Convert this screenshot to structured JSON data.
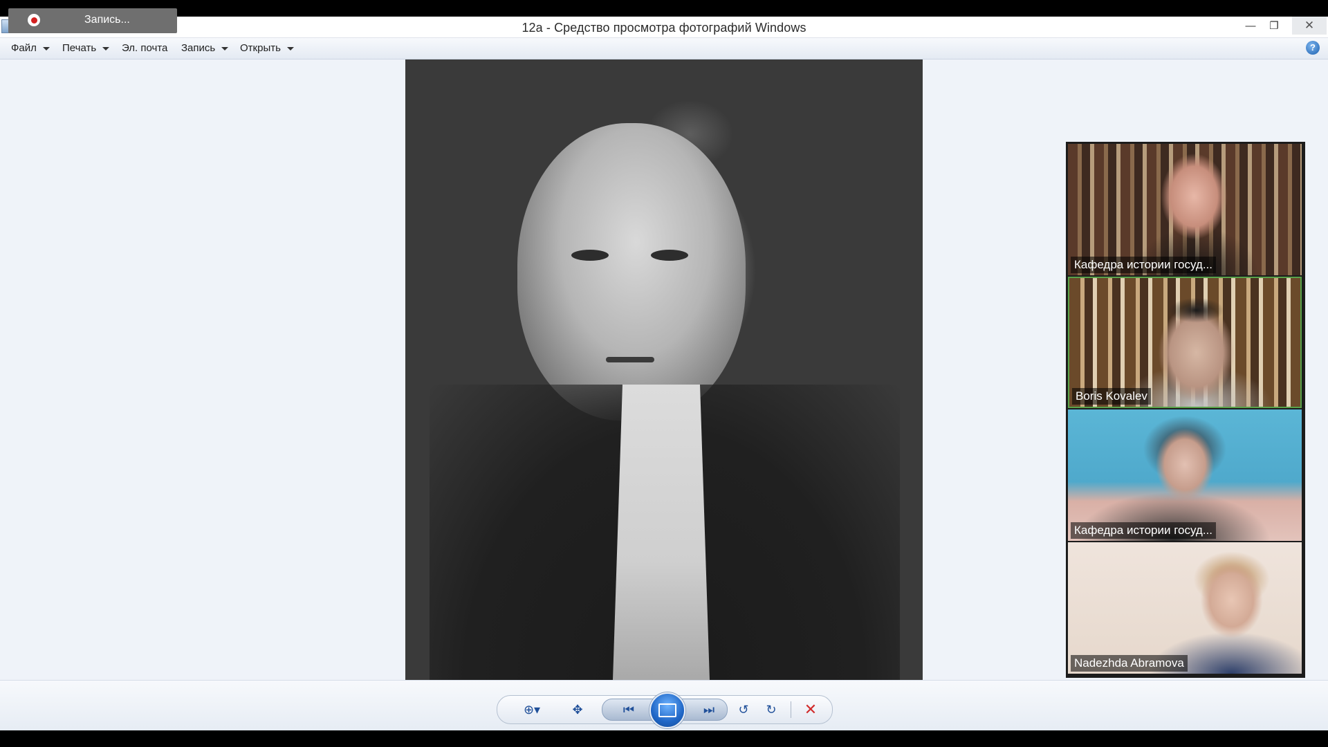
{
  "window": {
    "title": "12a - Средство просмотра фотографий Windows",
    "minimize_glyph": "—",
    "maximize_glyph": "❐",
    "close_glyph": "✕"
  },
  "recording": {
    "label": "Запись..."
  },
  "menu": {
    "items": [
      {
        "label": "Файл"
      },
      {
        "label": "Печать"
      },
      {
        "label": "Эл. почта"
      },
      {
        "label": "Запись"
      },
      {
        "label": "Открыть"
      }
    ],
    "help_glyph": "?"
  },
  "participants": [
    {
      "name": "Кафедра истории госуд..."
    },
    {
      "name": "Boris Kovalev"
    },
    {
      "name": "Кафедра истории госуд..."
    },
    {
      "name": "Nadezhda Abramova"
    }
  ],
  "controls": {
    "zoom_glyph": "⊕▾",
    "fit_glyph": "✥",
    "prev_glyph": "⏮",
    "next_glyph": "⏭",
    "rotate_left_glyph": "↺",
    "rotate_right_glyph": "↻",
    "delete_glyph": "✕"
  },
  "colors": {
    "accent": "#1f66c6",
    "delete": "#d12b2b",
    "active_speaker": "#5aa34a"
  }
}
